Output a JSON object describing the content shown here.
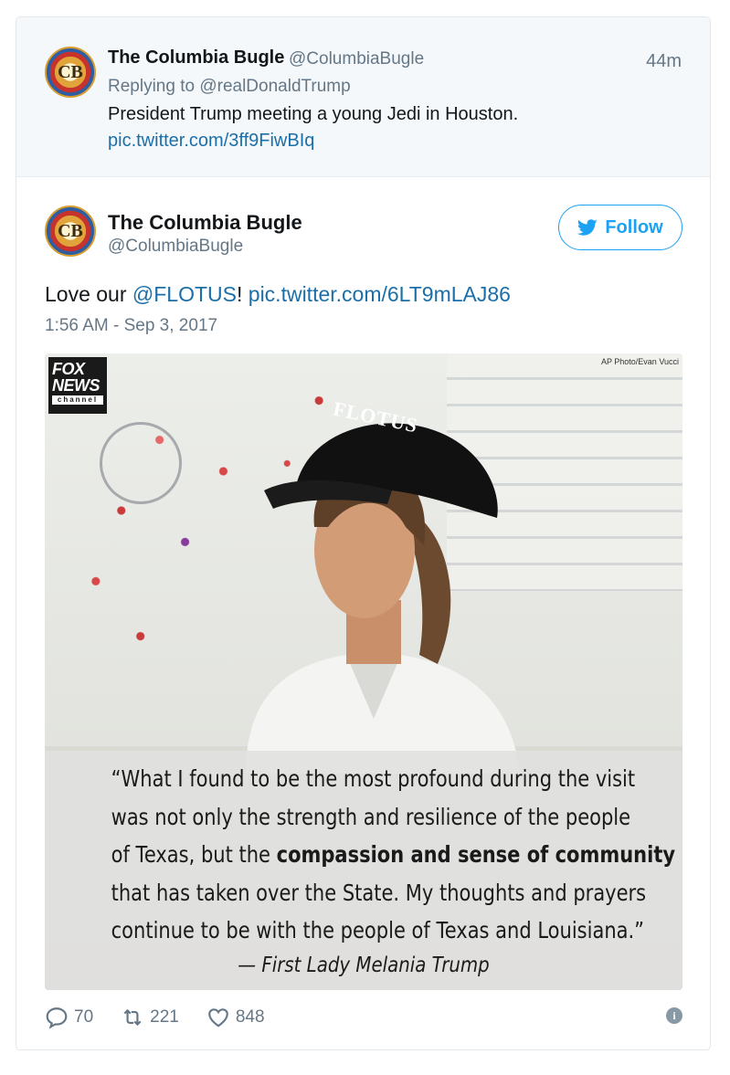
{
  "parent_tweet": {
    "author_name": "The Columbia Bugle",
    "author_handle": "@ColumbiaBugle",
    "time": "44m",
    "replying_to": "Replying to @realDonaldTrump",
    "text": "President Trump meeting a young Jedi in Houston.",
    "link": "pic.twitter.com/3ff9FiwBIq"
  },
  "main_tweet": {
    "author_name": "The Columbia Bugle",
    "author_handle": "@ColumbiaBugle",
    "follow_label": "Follow",
    "text_prefix": "Love our ",
    "mention": "@FLOTUS",
    "text_middle": "! ",
    "link": "pic.twitter.com/6LT9mLAJ86",
    "date": "1:56 AM - Sep 3, 2017"
  },
  "media": {
    "credit": "AP Photo/Evan Vucci",
    "logo_line1": "FOX",
    "logo_line2": "NEWS",
    "logo_line3": "channel",
    "cap_text": "FLOTUS",
    "quote_line1": "“What I found to be the most profound during the visit",
    "quote_line2": "was not only the strength and resilience of the people",
    "quote_line3_pre": "of Texas, but the ",
    "quote_line3_bold": "compassion and sense of community",
    "quote_line4": "that has taken over the State. My thoughts and prayers",
    "quote_line5": "continue to be with the people of Texas and Louisiana.”",
    "attribution": "— First Lady Melania Trump"
  },
  "actions": {
    "replies": "70",
    "retweets": "221",
    "likes": "848"
  },
  "colors": {
    "link": "#1b6fa9",
    "accent": "#1da1f2",
    "muted": "#657786"
  }
}
